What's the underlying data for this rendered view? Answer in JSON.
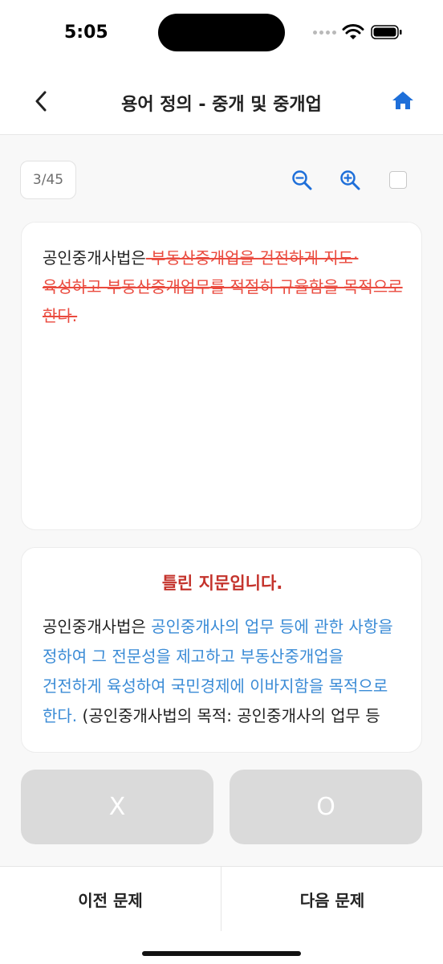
{
  "status_bar": {
    "time": "5:05"
  },
  "nav": {
    "title": "용어 정의 - 중개 및 중개업",
    "back_icon": "chevron-left-icon",
    "home_icon": "home-icon"
  },
  "toolbar": {
    "page_counter": "3/45",
    "zoom_out_icon": "zoom-out-icon",
    "zoom_in_icon": "zoom-in-icon",
    "bookmark_checked": false
  },
  "question": {
    "prefix": "공인중개사법은",
    "struck_text": " 부동산중개업을 건전하게 지도·육성하고 부동산중개업무를 적절히 규율함을 목적으로 한다."
  },
  "answer": {
    "title": "틀린 지문입니다.",
    "prefix": "공인중개사법은 ",
    "highlight": "공인중개사의 업무 등에 관한 사항을 정하여 그 전문성을 제고하고 부동산중개업을 건전하게 육성하여 국민경제에 이바지함을 목적으로 한다.",
    "suffix": " (공인중개사법의 목적: 공인중개사의 업무 등"
  },
  "buttons": {
    "x_label": "X",
    "o_label": "O"
  },
  "bottom_nav": {
    "prev_label": "이전 문제",
    "next_label": "다음 문제"
  },
  "colors": {
    "accent": "#1e6fd9",
    "wrong": "#c4332c",
    "struck": "#ea4a3e",
    "highlight": "#3a8bd6",
    "button_disabled": "#dadada"
  }
}
